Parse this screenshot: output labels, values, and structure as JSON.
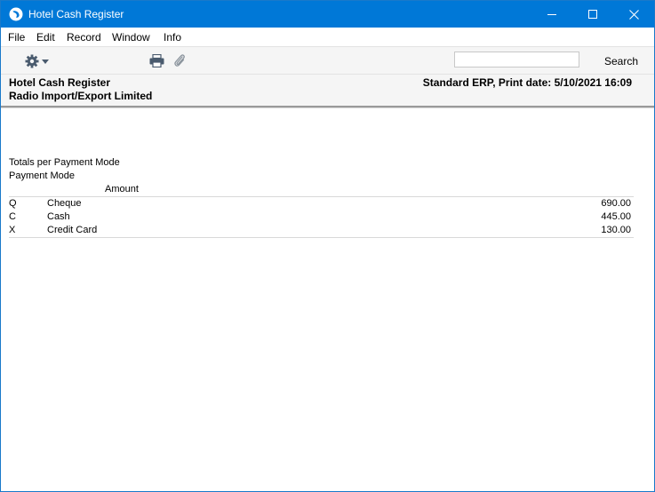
{
  "window": {
    "title": "Hotel Cash Register"
  },
  "menu": {
    "file": "File",
    "edit": "Edit",
    "record": "Record",
    "window": "Window",
    "info": "Info"
  },
  "toolbar": {
    "search_value": "",
    "search_label": "Search"
  },
  "report": {
    "title": "Hotel Cash Register",
    "company": "Radio Import/Export Limited",
    "print_info": "Standard ERP, Print date: 5/10/2021 16:09",
    "section_title": "Totals per Payment Mode",
    "column_mode": "Payment Mode",
    "column_amount": "Amount",
    "rows": [
      {
        "code": "Q",
        "name": "Cheque",
        "amount": "690.00"
      },
      {
        "code": "C",
        "name": "Cash",
        "amount": "445.00"
      },
      {
        "code": "X",
        "name": "Credit Card",
        "amount": "130.00"
      }
    ]
  },
  "colors": {
    "titlebar": "#0078d7",
    "toolbar_bg": "#f5f5f5",
    "icon_gray": "#4a5b6e"
  },
  "icons": [
    "app-icon",
    "minimize-icon",
    "maximize-icon",
    "close-icon",
    "gear-icon",
    "chevron-down-icon",
    "print-icon",
    "paperclip-icon"
  ]
}
